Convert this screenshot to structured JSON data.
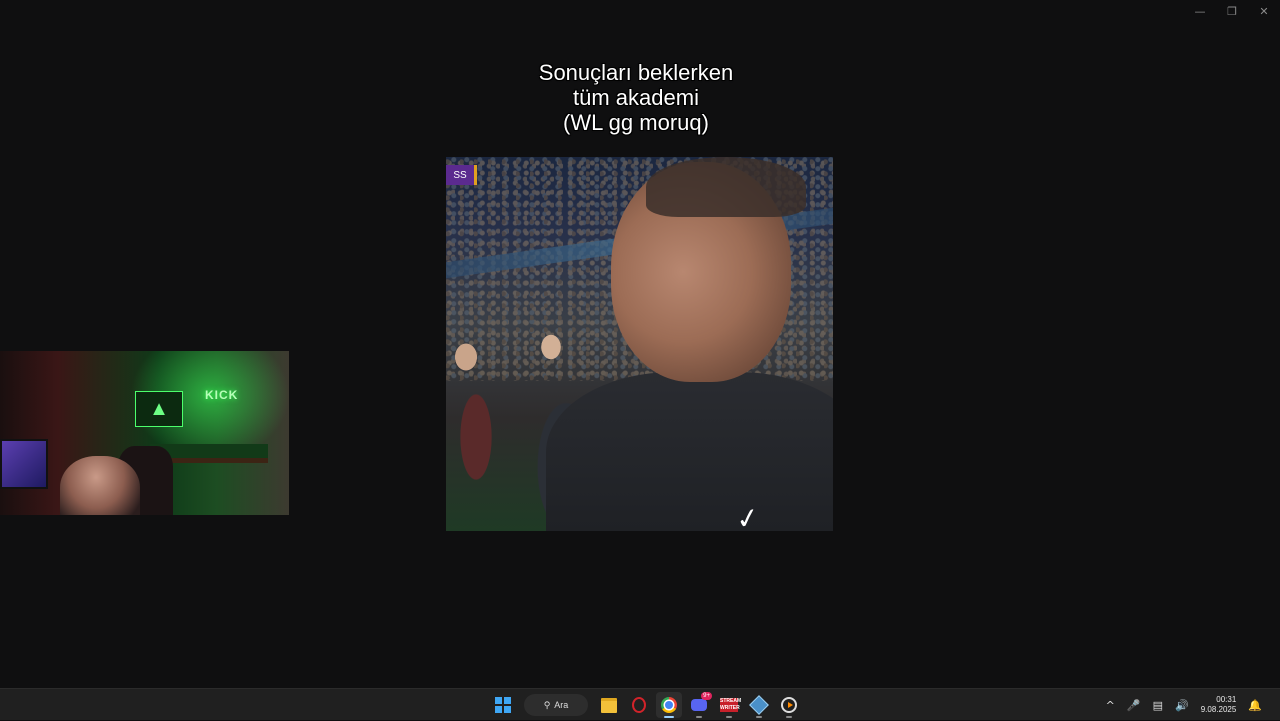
{
  "window": {
    "minimize_glyph": "—",
    "restore_glyph": "❐",
    "close_glyph": "✕"
  },
  "caption": {
    "line1": "Sonuçları beklerken",
    "line2": "tüm akademi",
    "line3": "(WL gg moruq)"
  },
  "video": {
    "score_badge": "SS",
    "shirt_logo": "nike-swoosh"
  },
  "webcam": {
    "neon_sign": "KICK"
  },
  "taskbar": {
    "search_label": "Ara",
    "discord_badge": "9+",
    "streamer_app_label": "STREAM WRITER",
    "apps": [
      "start",
      "search",
      "file-explorer",
      "opera",
      "chrome",
      "discord",
      "streamer-app",
      "crystal-app",
      "media-player"
    ]
  },
  "tray": {
    "time": "00:31",
    "date": "9.08.2025"
  },
  "colors": {
    "background": "#0f0f10",
    "taskbar": "#202020",
    "windows_accent": "#3fa7f5"
  }
}
